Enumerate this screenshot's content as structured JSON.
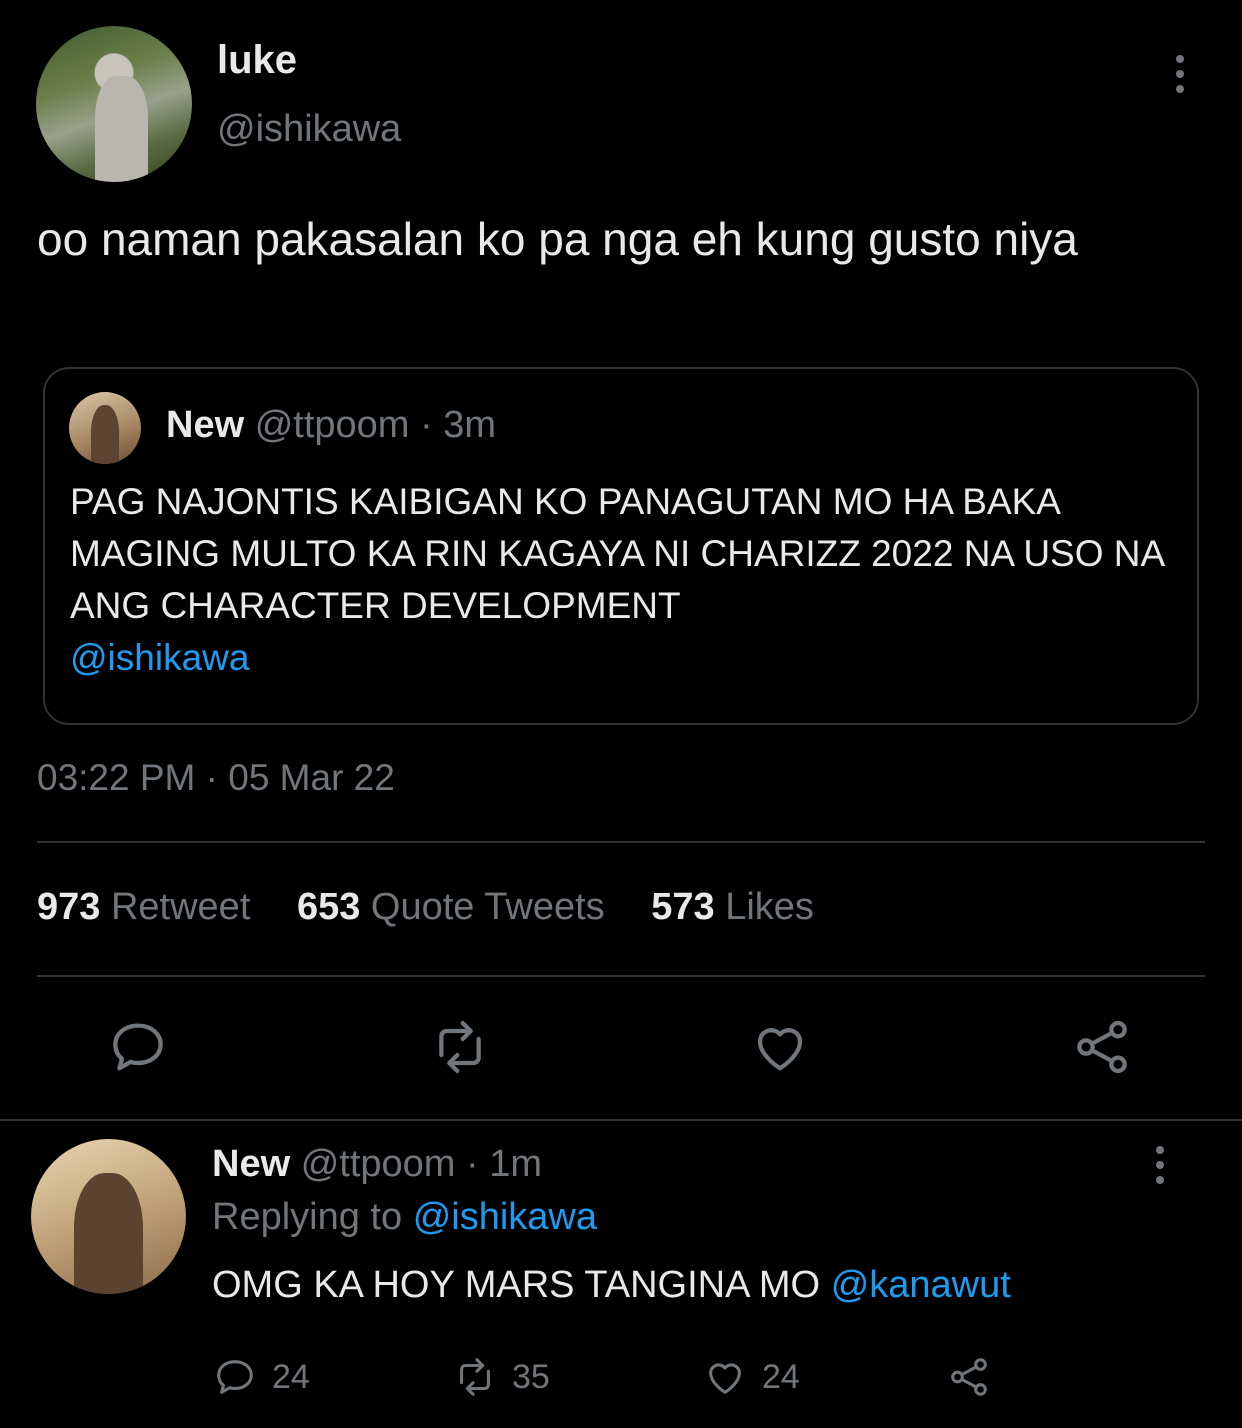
{
  "main_tweet": {
    "author_name": "luke",
    "author_handle": "@ishikawa",
    "text": "oo naman pakasalan ko pa nga eh kung gusto niya",
    "timestamp": "03:22 PM · 05 Mar 22"
  },
  "quoted_tweet": {
    "author_name": "New",
    "author_handle": "@ttpoom",
    "separator": "·",
    "age": "3m",
    "text": "PAG NAJONTIS KAIBIGAN KO PANAGUTAN MO HA BAKA MAGING MULTO KA RIN KAGAYA NI CHARIZZ 2022 NA USO NA ANG CHARACTER DEVELOPMENT",
    "mention": "@ishikawa"
  },
  "stats": [
    {
      "count": "973",
      "label": "Retweet"
    },
    {
      "count": "653",
      "label": "Quote Tweets"
    },
    {
      "count": "573",
      "label": "Likes"
    }
  ],
  "actions": [
    "reply-icon",
    "retweet-icon",
    "like-icon",
    "share-icon"
  ],
  "reply": {
    "author_name": "New",
    "author_handle": "@ttpoom",
    "separator": "·",
    "age": "1m",
    "replying_label": "Replying to",
    "replying_to": "@ishikawa",
    "text": "OMG KA HOY MARS TANGINA MO",
    "mention": "@kanawut",
    "reply_count": "24",
    "retweet_count": "35",
    "like_count": "24"
  },
  "colors": {
    "background": "#000000",
    "text": "#e7e9ea",
    "muted": "#71767b",
    "link": "#1d9bf0",
    "divider": "#2f3336"
  }
}
